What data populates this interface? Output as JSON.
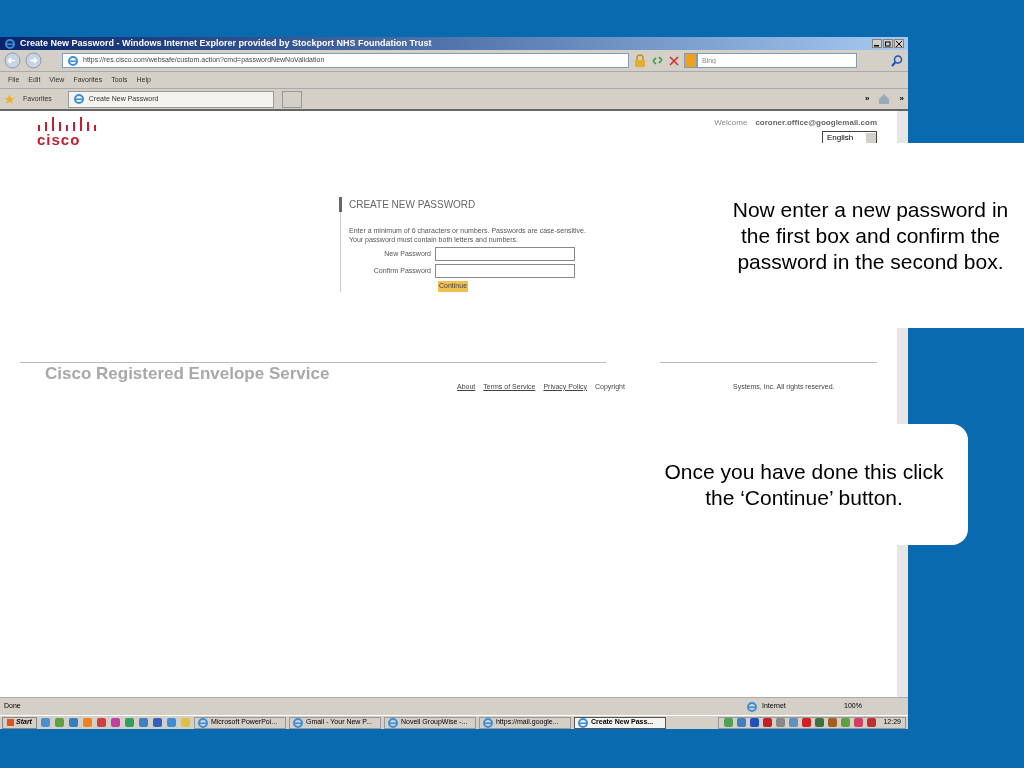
{
  "window": {
    "title": "Create New Password - Windows Internet Explorer provided by Stockport NHS Foundation Trust"
  },
  "address": {
    "url": "https://res.cisco.com/websafe/custom.action?cmd=passwordNewNoValidation",
    "search_placeholder": "Bing"
  },
  "menu": [
    "File",
    "Edit",
    "View",
    "Favorites",
    "Tools",
    "Help"
  ],
  "favorites": {
    "label": "Favorites",
    "tab": "Create New Password",
    "chevrons": [
      "»",
      "»"
    ]
  },
  "page": {
    "logo_text": "cisco",
    "welcome": "Welcome",
    "email": "coroner.office@googlemail.com",
    "language": "English",
    "heading": "CREATE NEW PASSWORD",
    "instructions": "Enter a minimum of 6 characters or numbers. Passwords are case-sensitive. Your password must contain both letters and numbers.",
    "fields": [
      {
        "label": "New Password"
      },
      {
        "label": "Confirm Password"
      }
    ],
    "button": "Continue",
    "brand": "Cisco Registered Envelope Service",
    "links": [
      "About",
      "Terms of Service",
      "Privacy Policy"
    ],
    "copyright_start": "Copyright",
    "copyright_end": "Systems, Inc. All rights reserved."
  },
  "status_bar": {
    "text": "Done",
    "zone": "Internet",
    "zoom": "100%"
  },
  "taskbar": {
    "start": "Start",
    "tasks": [
      {
        "label": "Microsoft PowerPoi...",
        "selected": false
      },
      {
        "label": "Gmail - Your New P...",
        "selected": false
      },
      {
        "label": "Novell GroupWise -...",
        "selected": false
      },
      {
        "label": "https://mail.google...",
        "selected": false
      },
      {
        "label": "Create New Pass...",
        "selected": true
      }
    ],
    "clock": "12:29"
  },
  "callouts": [
    "Now enter a new password in the first box and confirm the password in the second box.",
    "Once you have done this click the ‘Continue’ button."
  ]
}
